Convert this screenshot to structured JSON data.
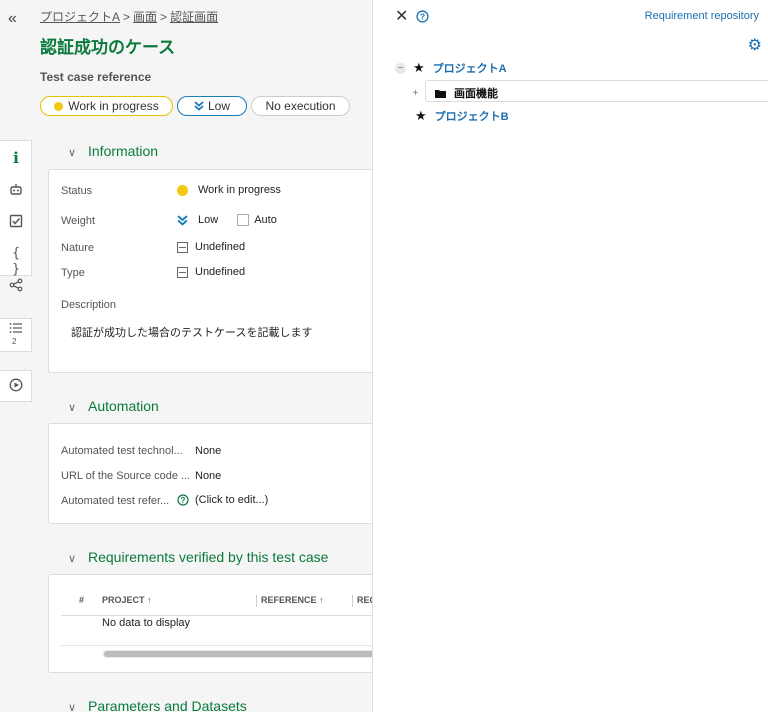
{
  "breadcrumb": {
    "items": [
      "プロジェクトA",
      "画面",
      "認証画面"
    ],
    "separator": ">"
  },
  "page_title": "認証成功のケース",
  "test_case_reference_label": "Test case reference",
  "chips": {
    "status": "Work in progress",
    "weight": "Low",
    "execution": "No execution"
  },
  "sections": {
    "information": {
      "title": "Information",
      "fields": {
        "status_label": "Status",
        "status_value": "Work in progress",
        "weight_label": "Weight",
        "weight_value": "Low",
        "auto_label": "Auto",
        "nature_label": "Nature",
        "nature_value": "Undefined",
        "type_label": "Type",
        "type_value": "Undefined",
        "description_label": "Description",
        "description_value": "認証が成功した場合のテストケースを記載します"
      }
    },
    "automation": {
      "title": "Automation",
      "fields": {
        "tech_label": "Automated test technol...",
        "tech_value": "None",
        "url_label": "URL of the Source code ...",
        "url_value": "None",
        "ref_label": "Automated test refer...",
        "ref_value": "(Click to edit...)"
      }
    },
    "requirements": {
      "title": "Requirements verified by this test case",
      "columns": [
        "#",
        "PROJECT",
        "REFERENCE",
        "REQ"
      ],
      "empty": "No data to display"
    },
    "parameters": {
      "title": "Parameters and Datasets"
    }
  },
  "sidebar": {
    "steps_count": "2"
  },
  "panel": {
    "repository_link": "Requirement repository",
    "tree": [
      {
        "label": "プロジェクトA",
        "expanded": true
      },
      {
        "label": "画面機能",
        "type": "folder"
      },
      {
        "label": "プロジェクトB",
        "expanded": false
      }
    ]
  },
  "colors": {
    "accent_green": "#0a7a3c",
    "status_yellow": "#f2c811",
    "weight_blue": "#1a7bb9",
    "link_blue": "#1a6fb0"
  }
}
